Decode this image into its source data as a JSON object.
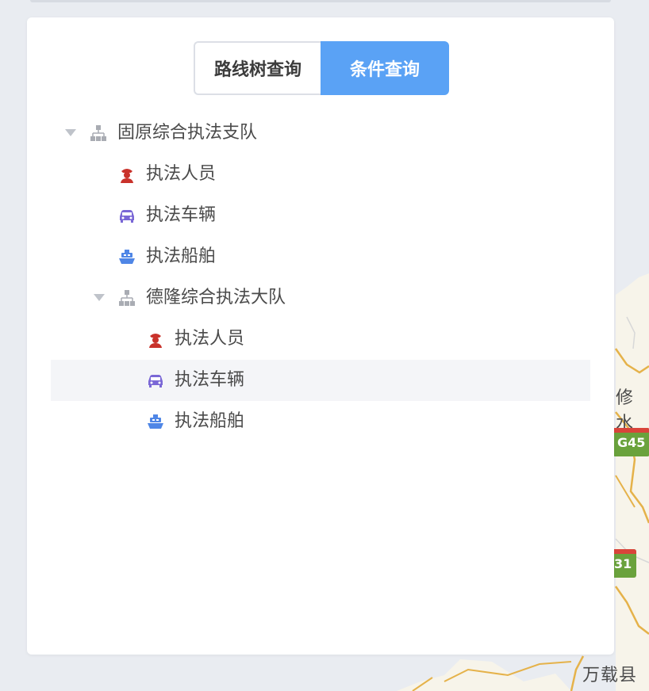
{
  "tabs": {
    "route_tree": "路线树查询",
    "condition": "条件查询"
  },
  "tree": {
    "root": {
      "label": "固原综合执法支队",
      "children": [
        "执法人员",
        "执法车辆",
        "执法船舶"
      ],
      "sub": {
        "label": "德隆综合执法大队",
        "children": [
          "执法人员",
          "执法车辆",
          "执法船舶"
        ]
      }
    }
  },
  "map": {
    "labels": [
      "修水",
      "万载县"
    ],
    "shields": [
      "G45",
      "31"
    ]
  },
  "colors": {
    "accent": "#5aa2f5",
    "person_icon": "#c9322b",
    "vehicle_icon": "#7a67d6",
    "ship_icon": "#4f86e6"
  },
  "icons": {
    "org": "org-tree-icon",
    "person": "officer-icon",
    "vehicle": "car-icon",
    "ship": "ship-icon"
  }
}
